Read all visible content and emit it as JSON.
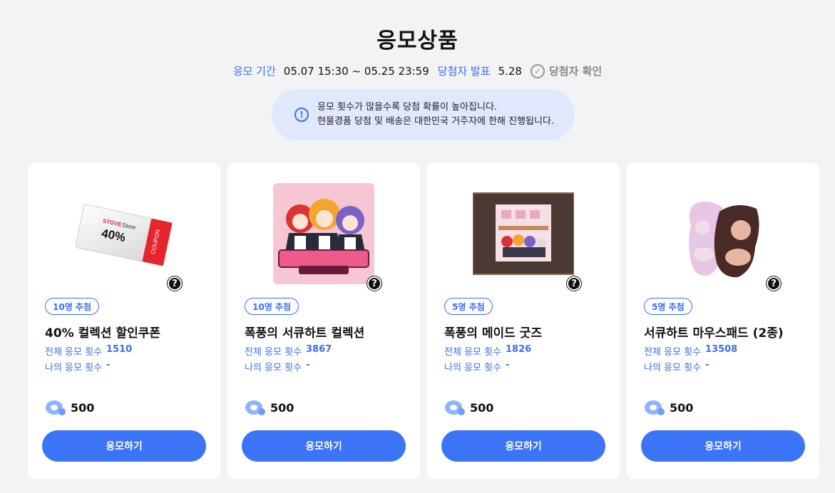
{
  "header": {
    "title": "응모상품",
    "period_label": "응모 기간",
    "period_value": "05.07 15:30 ~ 05.25 23:59",
    "announce_label": "당첨자 발표",
    "announce_value": "5.28",
    "winner_check_label": "당첨자 확인"
  },
  "notice": {
    "line1": "응모 횟수가 많을수록 당첨 확률이 높아집니다.",
    "line2": "현물경품 당첨 및 배송은 대한민국 거주자에 한해 진행됩니다."
  },
  "labels": {
    "total_entries": "전체 응모 횟수",
    "my_entries": "나의 응모 횟수",
    "apply_button": "응모하기",
    "help_icon": "?"
  },
  "coupon_text": {
    "brand": "STOVE",
    "store": "Store",
    "percent": "40%",
    "coupon": "COUPON"
  },
  "cards": [
    {
      "badge": "10명 추첨",
      "name": "40% 컬렉션 할인쿠폰",
      "total": "1510",
      "mine": "-",
      "price": "500",
      "image": "coupon-image"
    },
    {
      "badge": "10명 추첨",
      "name": "폭풍의 서큐하트 컬렉션",
      "total": "3867",
      "mine": "-",
      "price": "500",
      "image": "maid-collection-cover-image"
    },
    {
      "badge": "5명 추첨",
      "name": "폭풍의 메이드 굿즈",
      "total": "1826",
      "mine": "-",
      "price": "500",
      "image": "maid-goods-image"
    },
    {
      "badge": "5명 추첨",
      "name": "서큐하트 마우스패드 (2종)",
      "total": "13508",
      "mine": "-",
      "price": "500",
      "image": "mousepad-image"
    }
  ],
  "colors": {
    "accent": "#3b74f6",
    "background": "#f2f3f5",
    "notice_bg": "#e0e8fe"
  }
}
